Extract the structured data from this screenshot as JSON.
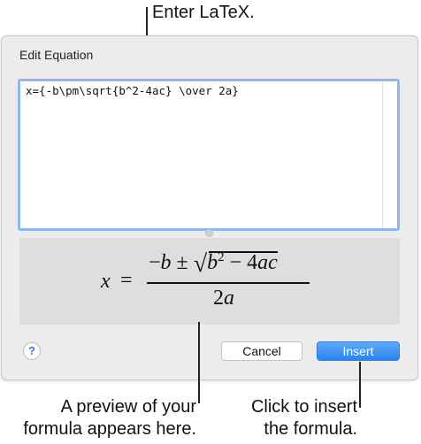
{
  "callouts": {
    "latex": "Enter LaTeX.",
    "preview_line1": "A preview of your",
    "preview_line2": "formula appears here.",
    "insert_line1": "Click to insert",
    "insert_line2": "the formula."
  },
  "dialog": {
    "title": "Edit Equation",
    "latex_value": "x={-b\\pm\\sqrt{b^2-4ac} \\over 2a}",
    "preview": {
      "lhs": "x",
      "equals": "=",
      "num_minus": "−",
      "num_b": "b",
      "num_pm": " ± ",
      "radical": "√",
      "rad_b": "b",
      "rad_exp": "2",
      "rad_minus": " − 4",
      "rad_ac": "ac",
      "den_2": "2",
      "den_a": "a"
    },
    "help_label": "?",
    "cancel_label": "Cancel",
    "insert_label": "Insert",
    "accent_color": "#2a82f0"
  }
}
